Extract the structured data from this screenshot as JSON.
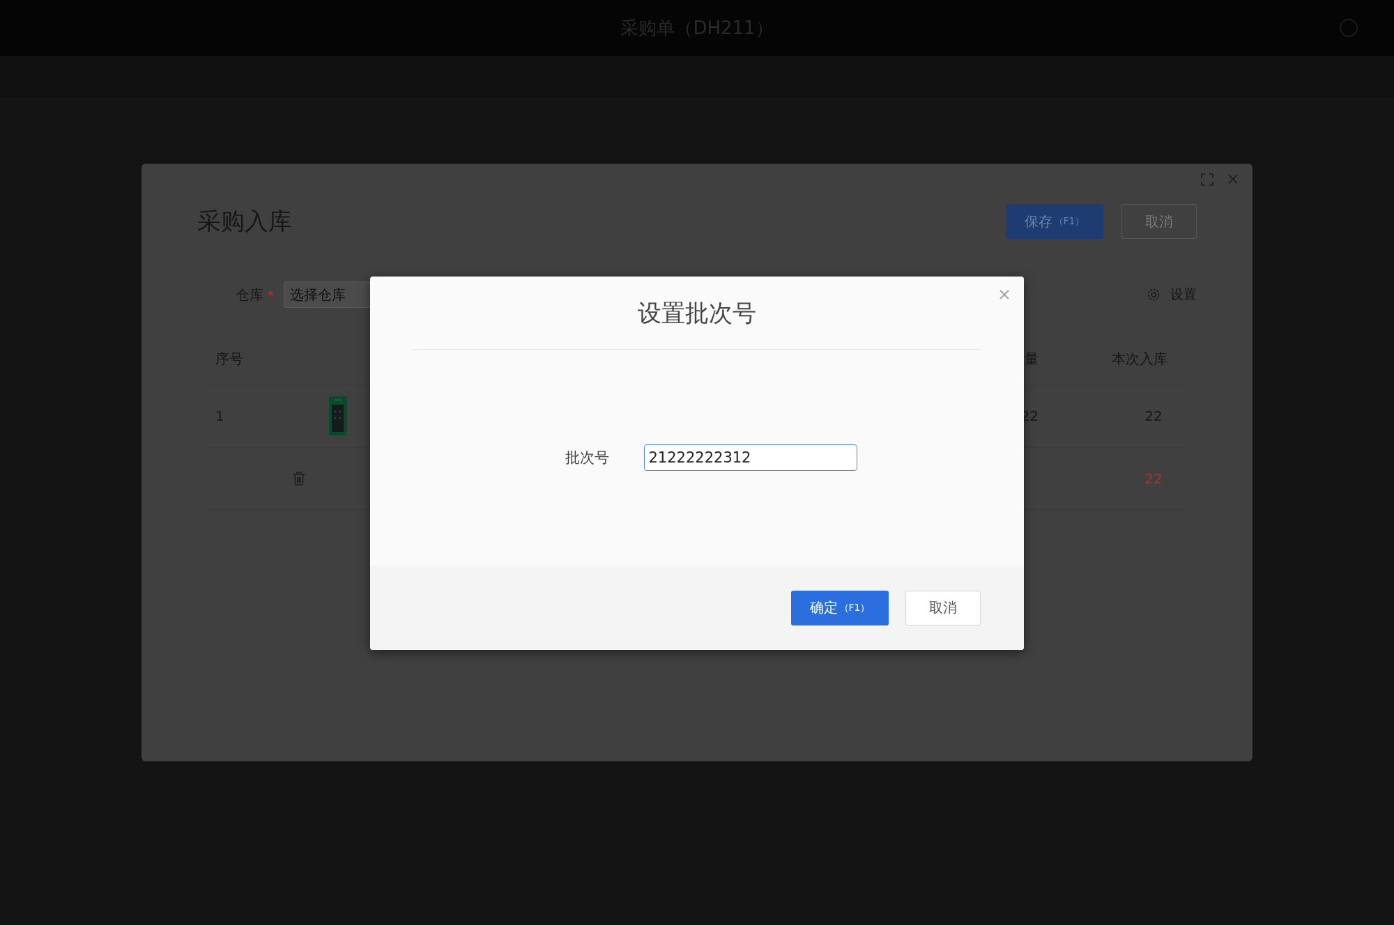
{
  "app_title": "采购单（DH211）",
  "page_dialog": {
    "title": "采购入库",
    "buttons": [
      {
        "label": "保存",
        "shortcut": "（F1）",
        "kind": "primary"
      },
      {
        "label": "取消",
        "kind": "default"
      }
    ],
    "form": {
      "label": "仓库",
      "required_mark": "*",
      "placeholder": "选择仓库"
    },
    "settings": "设置",
    "table": {
      "columns": [
        "序号",
        "量",
        "本次入库"
      ],
      "rows": [
        {
          "kind": "item",
          "index": "1",
          "column_2": "22",
          "receive": "22"
        },
        {
          "kind": "total",
          "receive": "22"
        }
      ]
    }
  },
  "modal": {
    "title": "设置批次号",
    "field": {
      "label": "批次号",
      "value": "21222222312"
    },
    "buttons": [
      {
        "label": "确定",
        "shortcut": "（F1）",
        "kind": "primary"
      },
      {
        "label": "取消",
        "kind": "default"
      }
    ]
  }
}
